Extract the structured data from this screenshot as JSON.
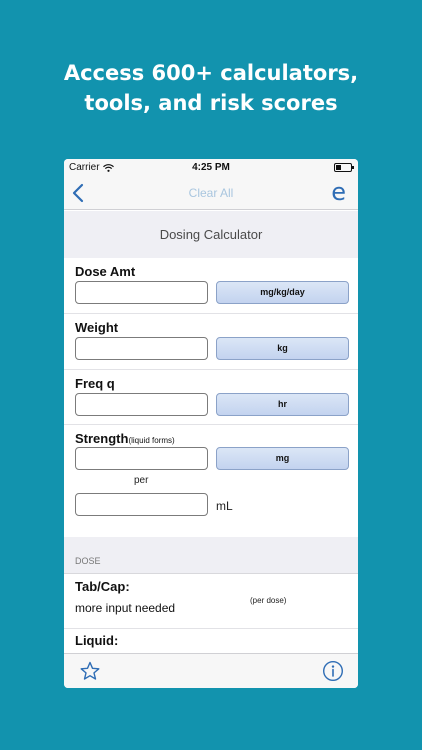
{
  "headline": {
    "line1": "Access 600+ calculators,",
    "line2": "tools, and risk scores"
  },
  "status_bar": {
    "carrier": "Carrier",
    "time": "4:25 PM"
  },
  "nav": {
    "clear_all": "Clear All",
    "logo": "e"
  },
  "page_title": "Dosing Calculator",
  "fields": {
    "dose_amt": {
      "label": "Dose Amt",
      "value": "",
      "unit": "mg/kg/day"
    },
    "weight": {
      "label": "Weight",
      "value": "",
      "unit": "kg"
    },
    "freq": {
      "label": "Freq q",
      "value": "",
      "unit": "hr"
    },
    "strength": {
      "label": "Strength",
      "hint": "(liquid forms)",
      "value": "",
      "unit": "mg",
      "per_label": "per",
      "per_value": "",
      "per_unit": "mL"
    }
  },
  "dose_section": {
    "header": "DOSE",
    "tab_cap": {
      "label": "Tab/Cap:",
      "value": "more input needed",
      "note": "(per dose)"
    },
    "liquid": {
      "label": "Liquid:"
    }
  },
  "icons": {
    "back": "chevron-left-icon",
    "favorite": "star-icon",
    "info": "info-icon"
  },
  "colors": {
    "background": "#1293ae",
    "accent": "#2f6db5",
    "unit_button": "#c3d3ef"
  }
}
